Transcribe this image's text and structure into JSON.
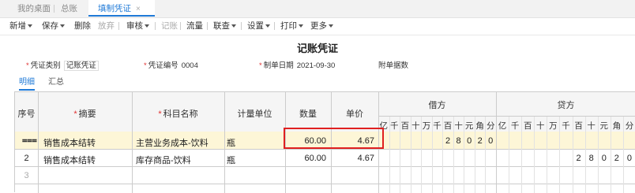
{
  "tabs": [
    {
      "label": "我的桌面"
    },
    {
      "label": "总账"
    },
    {
      "label": "填制凭证",
      "close": "×"
    }
  ],
  "toolbar": {
    "new": "新增",
    "save": "保存",
    "delete": "删除",
    "abandon": "放弃",
    "audit": "审核",
    "post": "记账",
    "flow": "流量",
    "query": "联查",
    "settings": "设置",
    "print": "打印",
    "more": "更多"
  },
  "voucher": {
    "title": "记账凭证",
    "type_label": "凭证类别",
    "type_value": "记账凭证",
    "number_label": "凭证编号",
    "number_value": "0004",
    "date_label": "制单日期",
    "date_value": "2021-09-30",
    "attachments_label": "附单据数"
  },
  "subtabs": {
    "detail": "明细",
    "summary": "汇总"
  },
  "table": {
    "headers": {
      "seq": "序号",
      "summary": "摘要",
      "subject": "科目名称",
      "unit": "计量单位",
      "quantity": "数量",
      "price": "单价",
      "debit": "借方",
      "credit": "贷方"
    },
    "digit_units": [
      "亿",
      "千",
      "百",
      "十",
      "万",
      "千",
      "百",
      "十",
      "元",
      "角",
      "分"
    ],
    "rows": [
      {
        "seq": "",
        "summary": "销售成本结转",
        "subject": "主营业务成本-饮料",
        "unit": "瓶",
        "quantity": "60.00",
        "price": "4.67",
        "debit": [
          "2",
          "8",
          "0",
          "2",
          "0"
        ],
        "credit": []
      },
      {
        "seq": "2",
        "summary": "销售成本结转",
        "subject": "库存商品-饮料",
        "unit": "瓶",
        "quantity": "60.00",
        "price": "4.67",
        "debit": [],
        "credit": [
          "2",
          "8",
          "0",
          "2",
          "0"
        ]
      },
      {
        "seq": "3",
        "summary": "",
        "subject": "",
        "unit": "",
        "quantity": "",
        "price": "",
        "debit": [],
        "credit": []
      }
    ]
  },
  "colors": {
    "accent": "#1f7ad7",
    "highlight_row": "#fdf6d7",
    "emphasis_box": "#e02020"
  }
}
